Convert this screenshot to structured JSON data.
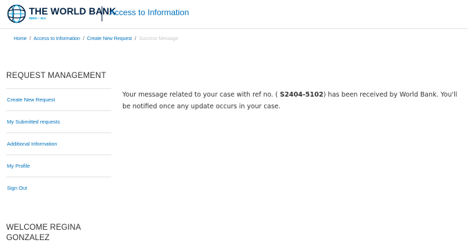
{
  "header": {
    "logo_name": "THE WORLD BANK",
    "logo_subtitle": "IBRD • IDA",
    "site_title": "Access to Information"
  },
  "breadcrumb": {
    "items": [
      "Home",
      "Access to Information",
      "Create New Request",
      "Success Message"
    ],
    "separator": "/"
  },
  "sidebar": {
    "title": "REQUEST MANAGEMENT",
    "items": [
      {
        "label": "Create New Request"
      },
      {
        "label": "My Submitted requests"
      },
      {
        "label": "Additional Information"
      },
      {
        "label": "My Profile"
      },
      {
        "label": "Sign Out"
      }
    ],
    "welcome": "WELCOME REGINA GONZALEZ"
  },
  "message": {
    "before": "Your message related to your case with ref no. ( ",
    "ref_no": "S2404-5102",
    "after": ") has been received by World Bank. You'll be notified once any update occurs in your case."
  },
  "colors": {
    "brand_navy": "#002244",
    "link_blue": "#0071bc",
    "accent_cyan": "#009fda"
  }
}
